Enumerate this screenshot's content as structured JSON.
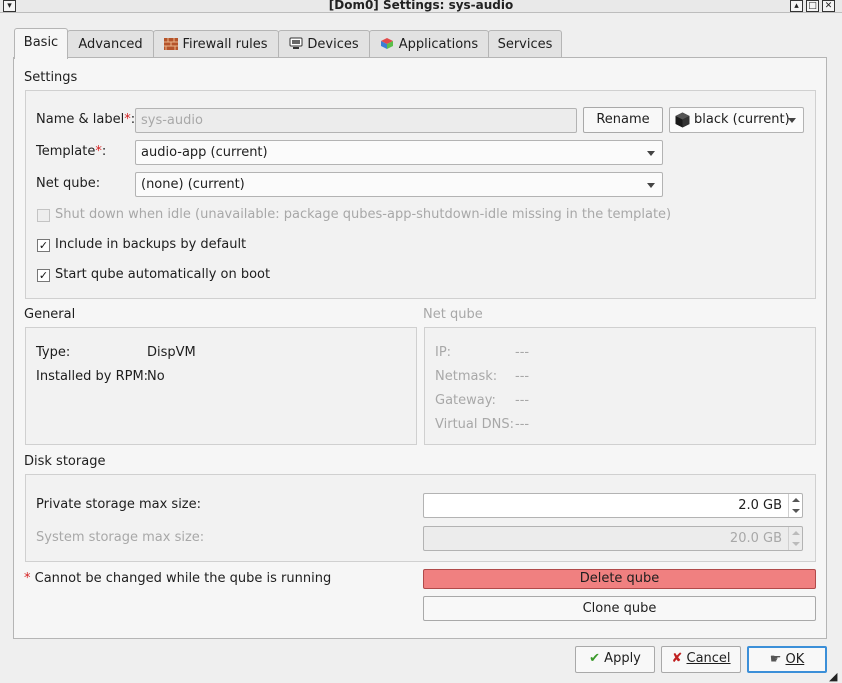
{
  "window": {
    "title": "[Dom0] Settings: sys-audio"
  },
  "tabs": [
    {
      "label": "Basic",
      "active": true
    },
    {
      "label": "Advanced"
    },
    {
      "label": "Firewall rules",
      "icon": "firewall-icon"
    },
    {
      "label": "Devices",
      "icon": "devices-icon"
    },
    {
      "label": "Applications",
      "icon": "applications-icon"
    },
    {
      "label": "Services"
    }
  ],
  "settings": {
    "title": "Settings",
    "name_label": "Name & label",
    "required_mark": "*",
    "colon": ":",
    "name_value": "sys-audio",
    "rename_button": "Rename",
    "label_value": "black (current)",
    "template_label": "Template",
    "template_value": "audio-app (current)",
    "netqube_label": "Net qube:",
    "netqube_value": "(none) (current)",
    "shutdown_idle": "Shut down when idle (unavailable: package qubes-app-shutdown-idle missing in the template)",
    "include_backups": "Include in backups by default",
    "start_on_boot": "Start qube automatically on boot"
  },
  "general": {
    "title": "General",
    "type_label": "Type:",
    "type_value": "DispVM",
    "rpm_label": "Installed by RPM:",
    "rpm_value": "No"
  },
  "net": {
    "title": "Net qube",
    "ip_label": "IP:",
    "ip_value": "---",
    "netmask_label": "Netmask:",
    "netmask_value": "---",
    "gateway_label": "Gateway:",
    "gateway_value": "---",
    "dns_label": "Virtual DNS:",
    "dns_value": "---"
  },
  "disk": {
    "title": "Disk storage",
    "private_label": "Private storage max size:",
    "private_value": "2.0 GB",
    "system_label": "System storage max size:",
    "system_value": "20.0 GB"
  },
  "footer_note": {
    "star": "*",
    "text": "Cannot be changed while the qube is running"
  },
  "actions": {
    "delete": "Delete qube",
    "clone": "Clone qube"
  },
  "dialog": {
    "apply": "Apply",
    "cancel": "Cancel",
    "ok": "OK"
  },
  "colors": {
    "required": "#d42020",
    "delete_bg": "#f08080",
    "focus": "#3b8fd8"
  }
}
